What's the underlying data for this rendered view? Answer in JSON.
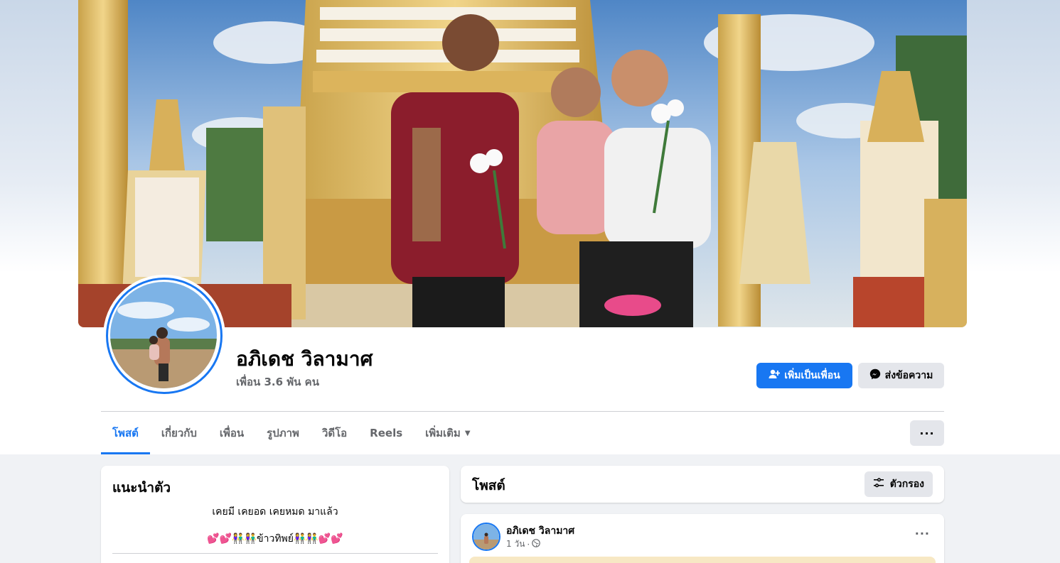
{
  "profile": {
    "name": "อภิเดช วิลามาศ",
    "friends": "เพื่อน 3.6 พัน คน"
  },
  "actions": {
    "add_friend": "เพิ่มเป็นเพื่อน",
    "message": "ส่งข้อความ",
    "more": "···"
  },
  "tabs": [
    {
      "label": "โพสต์",
      "active": true
    },
    {
      "label": "เกี่ยวกับ"
    },
    {
      "label": "เพื่อน"
    },
    {
      "label": "รูปภาพ"
    },
    {
      "label": "วิดีโอ"
    },
    {
      "label": "Reels"
    },
    {
      "label": "เพิ่มเติม"
    }
  ],
  "intro": {
    "title": "แนะนำตัว",
    "bio_line1": "เคยมี เคยอด เคยหมด มาแล้ว",
    "bio_line2": "💕💕👫👫ข้าวทิพย์👫👫💕💕"
  },
  "posts_section": {
    "title": "โพสต์",
    "filter": "ตัวกรอง"
  },
  "post": {
    "author": "อภิเดช วิลามาศ",
    "time": "1 วัน",
    "separator": "·",
    "privacy_icon": "globe-icon",
    "more": "···"
  },
  "colors": {
    "accent": "#1877f2",
    "secondary_button": "#e4e6eb",
    "page_bg": "#f0f2f5"
  }
}
